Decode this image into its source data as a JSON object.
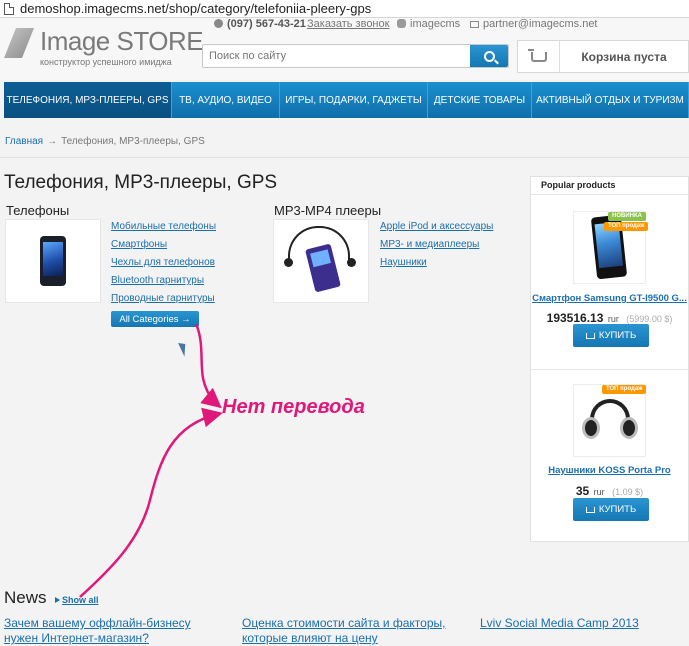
{
  "browser": {
    "url": "demoshop.imagecms.net/shop/category/telefoniia-pleery-gps"
  },
  "header": {
    "logo_name": "Image STORE",
    "logo_tagline": "конструктор успешного имиджа",
    "phone": "(097) 567-43-21",
    "callback": "Заказать звонок",
    "skype": "imagecms",
    "email": "partner@imagecms.net",
    "search_placeholder": "Поиск по сайту",
    "cart_label": "Корзина пуста"
  },
  "nav": [
    {
      "label": "ТЕЛЕФОНИЯ, МРЗ-ПЛЕЕРЫ, GPS"
    },
    {
      "label": "ТВ, АУДИО, ВИДЕО"
    },
    {
      "label": "ИГРЫ, ПОДАРКИ, ГАДЖЕТЫ"
    },
    {
      "label": "ДЕТСКИЕ ТОВАРЫ"
    },
    {
      "label": "АКТИВНЫЙ ОТДЫХ И ТУРИЗМ"
    }
  ],
  "breadcrumb": {
    "home": "Главная",
    "sep": "→",
    "current": "Телефония, MP3-плееры, GPS"
  },
  "page_title": "Телефония, MP3-плееры, GPS",
  "categories": [
    {
      "title": "Телефоны",
      "links": [
        "Мобильные телефоны",
        "Смартфоны",
        "Чехлы для телефонов",
        "Bluetooth гарнитуры",
        "Проводные гарнитуры"
      ]
    },
    {
      "title": "MP3-MP4 плееры",
      "links": [
        "Apple iPod и аксессуары",
        "MP3- и медиаплееры",
        "Наушники"
      ]
    }
  ],
  "all_categories_button": "All Categories →",
  "annotation": {
    "text": "Нет перевода",
    "color": "#e0187a"
  },
  "popular": {
    "title": "Popular products",
    "products": [
      {
        "name": "Смартфон Samsung GT-I9500 G...",
        "price": "193516.13",
        "currency": "rur",
        "alt_price": "(5999.00 $)",
        "buy": "КУПИТЬ",
        "badges": [
          "НОВИНКА",
          "ТОП продаж"
        ]
      },
      {
        "name": "Наушники KOSS Porta Pro",
        "price": "35",
        "currency": "rur",
        "alt_price": "(1.09 $)",
        "buy": "КУПИТЬ",
        "badges": [
          "ТОП продаж"
        ]
      }
    ]
  },
  "news": {
    "title": "News",
    "show_all": "Show all",
    "items": [
      {
        "line1": "Зачем вашему оффлайн-бизнесу",
        "line2": "нужен Интернет-магазин?"
      },
      {
        "line1": "Оценка стоимости сайта и факторы,",
        "line2": "которые влияют на цену"
      },
      {
        "line1": "Lviv Social Media Camp 2013",
        "line2": ""
      }
    ]
  },
  "colors": {
    "brand_blue": "#1477b3",
    "link": "#1a6fb0",
    "accent_pink": "#e0187a"
  }
}
